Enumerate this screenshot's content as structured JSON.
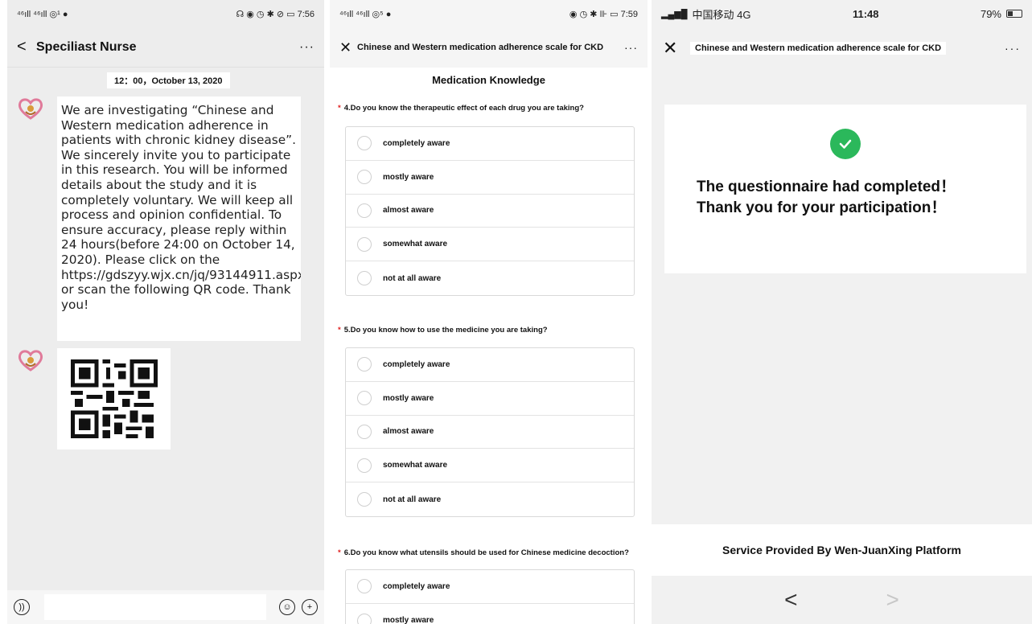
{
  "panel1": {
    "status": {
      "left": "⁴⁶ıll ⁴⁶ıll ◎¹ ●",
      "right": "☊ ◉ ◷ ✱ ⊘ ▭ 7:56"
    },
    "header": {
      "back": "<",
      "title": "Speciliast Nurse",
      "more": "···"
    },
    "timestamp": "12：00，October 13, 2020",
    "message": "We are investigating “Chinese and Western medication adherence in patients with chronic kidney disease”. We sincerely invite you to participate in this research. You will be informed details about the study and it is completely voluntary. We will keep all process and opinion confidential. To ensure accuracy, please reply within 24 hours(before 24:00 on October 14, 2020). Please click on the https://gdszyy.wjx.cn/jq/93144911.aspx or scan the following QR code. Thank you!"
  },
  "panel2": {
    "status": {
      "left": "⁴⁶ıll ⁴⁶ıll ◎⁵ ●",
      "right": "◉ ◷ ✱ ⊪ ▭ 7:59"
    },
    "header": {
      "close": "✕",
      "title": "Chinese and Western medication adherence scale for CKD",
      "more": "···"
    },
    "section_title": "Medication Knowledge",
    "questions": [
      {
        "star": "*",
        "text": "4.Do you know the therapeutic effect of each drug you are taking?",
        "options": [
          "completely aware",
          "mostly aware",
          "almost aware",
          "somewhat aware",
          "not at all aware"
        ]
      },
      {
        "star": "*",
        "text": "5.Do you know how to use the medicine you are taking?",
        "options": [
          "completely aware",
          "mostly aware",
          "almost aware",
          "somewhat aware",
          "not at all aware"
        ]
      },
      {
        "star": "*",
        "text": "6.Do you know what utensils should be used for Chinese medicine decoction?",
        "options": [
          "completely aware",
          "mostly aware"
        ]
      }
    ]
  },
  "panel3": {
    "status": {
      "carrier": "中国移动 4G",
      "time": "11:48",
      "battery": "79%"
    },
    "header": {
      "close": "✕",
      "title": "Chinese and Western medication adherence scale for CKD",
      "more": "···"
    },
    "message_line1": "The questionnaire had completed！",
    "message_line2": "Thank you for your participation！",
    "footer": "Service Provided By Wen-JuanXing Platform",
    "nav": {
      "back": "<",
      "forward": ">"
    }
  },
  "colors": {
    "check_green": "#2bb85b",
    "required_red": "#e02020",
    "chat_bg": "#ededed"
  }
}
